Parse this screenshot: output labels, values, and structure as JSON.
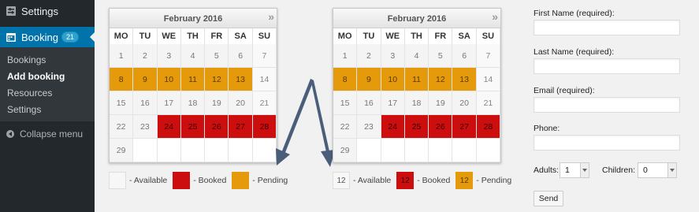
{
  "sidebar": {
    "settings_top": "Settings",
    "booking_label": "Booking",
    "booking_badge": "21",
    "submenu": [
      {
        "label": "Bookings"
      },
      {
        "label": "Add booking"
      },
      {
        "label": "Resources"
      },
      {
        "label": "Settings"
      }
    ],
    "collapse_label": "Collapse menu",
    "icons": {
      "settings": "settings-icon",
      "booking": "calendar-icon",
      "collapse": "collapse-icon"
    }
  },
  "calendars": [
    {
      "title": "February 2016",
      "next_icon": "»",
      "weekdays": [
        "MO",
        "TU",
        "WE",
        "TH",
        "FR",
        "SA",
        "SU"
      ],
      "days": [
        {
          "d": "1",
          "s": "available"
        },
        {
          "d": "2",
          "s": "available"
        },
        {
          "d": "3",
          "s": "available"
        },
        {
          "d": "4",
          "s": "available"
        },
        {
          "d": "5",
          "s": "available"
        },
        {
          "d": "6",
          "s": "available"
        },
        {
          "d": "7",
          "s": "weekend"
        },
        {
          "d": "8",
          "s": "pending"
        },
        {
          "d": "9",
          "s": "pending"
        },
        {
          "d": "10",
          "s": "pending"
        },
        {
          "d": "11",
          "s": "pending"
        },
        {
          "d": "12",
          "s": "pending"
        },
        {
          "d": "13",
          "s": "pending"
        },
        {
          "d": "14",
          "s": "weekend"
        },
        {
          "d": "15",
          "s": "available"
        },
        {
          "d": "16",
          "s": "available"
        },
        {
          "d": "17",
          "s": "available"
        },
        {
          "d": "18",
          "s": "available"
        },
        {
          "d": "19",
          "s": "available"
        },
        {
          "d": "20",
          "s": "available"
        },
        {
          "d": "21",
          "s": "weekend"
        },
        {
          "d": "22",
          "s": "available"
        },
        {
          "d": "23",
          "s": "available"
        },
        {
          "d": "24",
          "s": "booked"
        },
        {
          "d": "25",
          "s": "booked"
        },
        {
          "d": "26",
          "s": "booked"
        },
        {
          "d": "27",
          "s": "booked"
        },
        {
          "d": "28",
          "s": "booked"
        },
        {
          "d": "29",
          "s": "available"
        },
        {
          "d": "",
          "s": "empty"
        },
        {
          "d": "",
          "s": "empty"
        },
        {
          "d": "",
          "s": "empty"
        },
        {
          "d": "",
          "s": "empty"
        },
        {
          "d": "",
          "s": "empty"
        },
        {
          "d": "",
          "s": "empty"
        }
      ],
      "legend": [
        {
          "swatch_text": "",
          "label": "- Available",
          "kind": "available"
        },
        {
          "swatch_text": "",
          "label": "- Booked",
          "kind": "booked"
        },
        {
          "swatch_text": "",
          "label": "- Pending",
          "kind": "pending"
        }
      ]
    },
    {
      "title": "February 2016",
      "next_icon": "»",
      "weekdays": [
        "MO",
        "TU",
        "WE",
        "TH",
        "FR",
        "SA",
        "SU"
      ],
      "days": [
        {
          "d": "1",
          "s": "available"
        },
        {
          "d": "2",
          "s": "available"
        },
        {
          "d": "3",
          "s": "available"
        },
        {
          "d": "4",
          "s": "available"
        },
        {
          "d": "5",
          "s": "available"
        },
        {
          "d": "6",
          "s": "available"
        },
        {
          "d": "7",
          "s": "weekend"
        },
        {
          "d": "8",
          "s": "pending"
        },
        {
          "d": "9",
          "s": "pending"
        },
        {
          "d": "10",
          "s": "pending"
        },
        {
          "d": "11",
          "s": "pending"
        },
        {
          "d": "12",
          "s": "pending"
        },
        {
          "d": "13",
          "s": "pending"
        },
        {
          "d": "14",
          "s": "weekend"
        },
        {
          "d": "15",
          "s": "available"
        },
        {
          "d": "16",
          "s": "available"
        },
        {
          "d": "17",
          "s": "available"
        },
        {
          "d": "18",
          "s": "available"
        },
        {
          "d": "19",
          "s": "available"
        },
        {
          "d": "20",
          "s": "available"
        },
        {
          "d": "21",
          "s": "weekend"
        },
        {
          "d": "22",
          "s": "available"
        },
        {
          "d": "23",
          "s": "available"
        },
        {
          "d": "24",
          "s": "booked"
        },
        {
          "d": "25",
          "s": "booked"
        },
        {
          "d": "26",
          "s": "booked"
        },
        {
          "d": "27",
          "s": "booked"
        },
        {
          "d": "28",
          "s": "booked"
        },
        {
          "d": "29",
          "s": "available"
        },
        {
          "d": "",
          "s": "empty"
        },
        {
          "d": "",
          "s": "empty"
        },
        {
          "d": "",
          "s": "empty"
        },
        {
          "d": "",
          "s": "empty"
        },
        {
          "d": "",
          "s": "empty"
        },
        {
          "d": "",
          "s": "empty"
        }
      ],
      "legend": [
        {
          "swatch_text": "12",
          "label": "- Available",
          "kind": "available"
        },
        {
          "swatch_text": "12",
          "label": "- Booked",
          "kind": "booked"
        },
        {
          "swatch_text": "12",
          "label": "- Pending",
          "kind": "pending"
        }
      ]
    }
  ],
  "form": {
    "first_name_label": "First Name (required):",
    "last_name_label": "Last Name (required):",
    "email_label": "Email (required):",
    "phone_label": "Phone:",
    "adults_label": "Adults:",
    "adults_value": "1",
    "children_label": "Children:",
    "children_value": "0",
    "send_label": "Send"
  },
  "colors": {
    "sidebar_bg": "#23282d",
    "active_menu": "#0073aa",
    "booked": "#cd0e0e",
    "pending": "#e49a0a",
    "arrow": "#4a5e7a"
  }
}
